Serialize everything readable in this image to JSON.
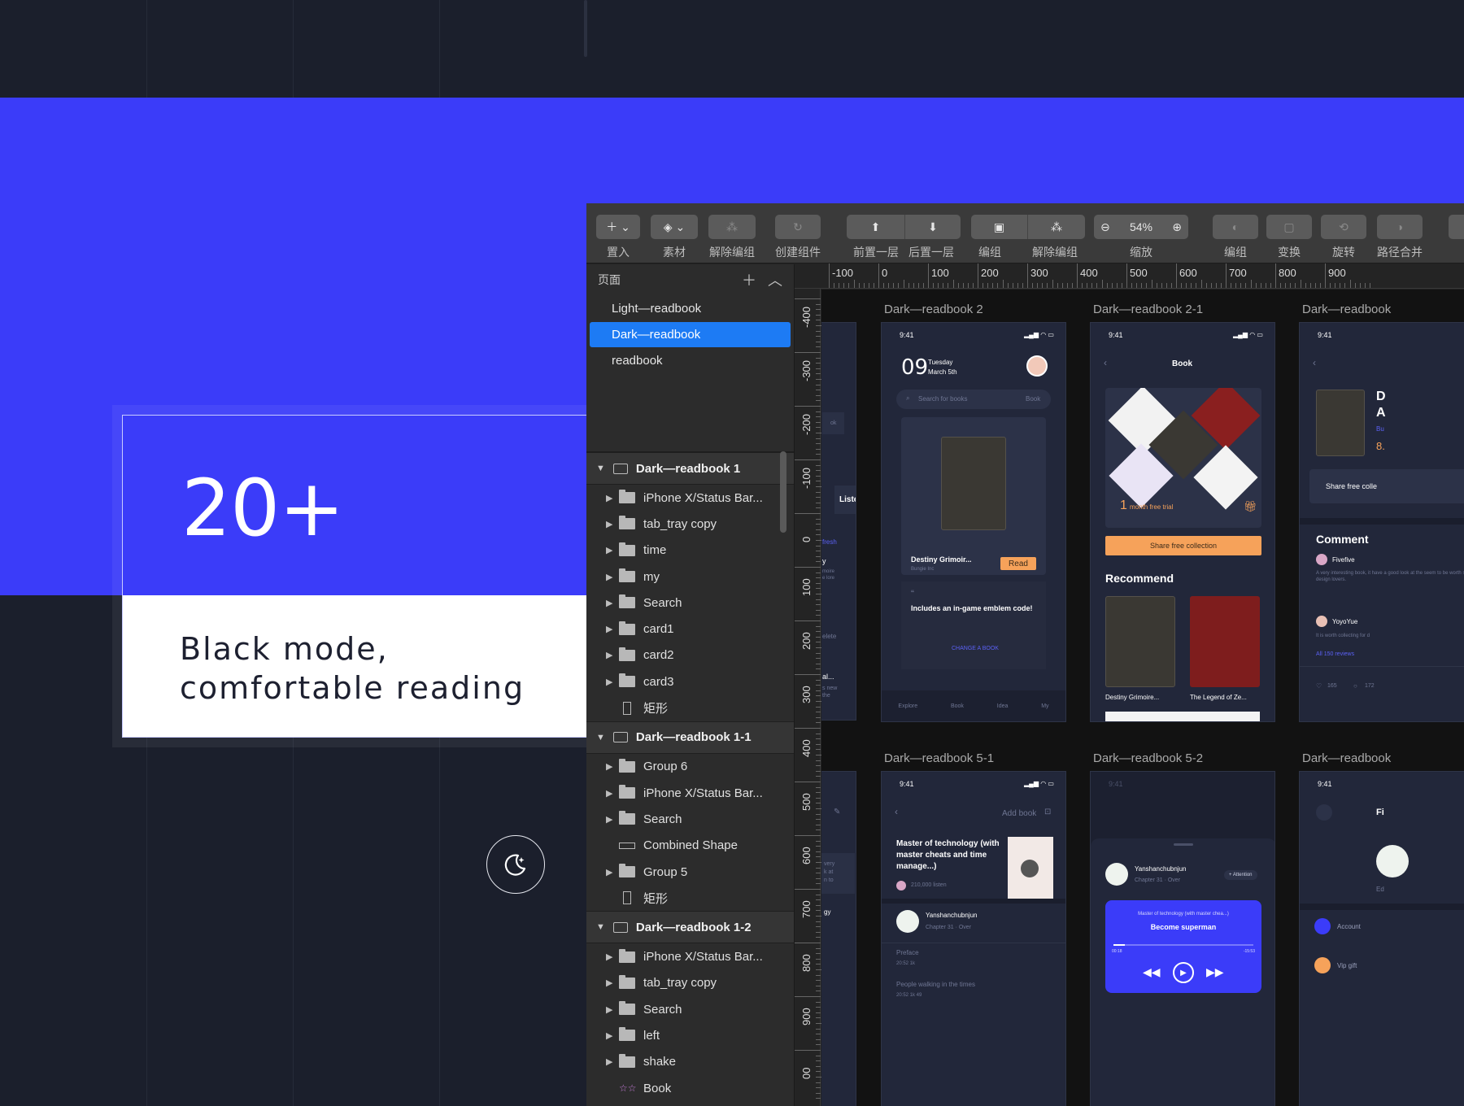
{
  "promo": {
    "number": "20+",
    "caption": "Black mode,\ncomfortable reading"
  },
  "toolbar": {
    "insert": "置入",
    "assets": "素材",
    "ungroup_disabled": "解除编组",
    "create_symbol": "创建组件",
    "bring_forward": "前置一层",
    "send_backward": "后置一层",
    "group": "编组",
    "ungroup": "解除编组",
    "zoom_value": "54%",
    "zoom_label": "缩放",
    "edit": "编组",
    "transform": "变换",
    "rotate": "旋转",
    "combine": "路径合并"
  },
  "sidebar": {
    "pages_title": "页面",
    "pages": [
      "Light—readbook",
      "Dark—readbook",
      "readbook"
    ],
    "artboard1": {
      "name": "Dark—readbook 1",
      "layers": [
        "iPhone X/Status Bar...",
        "tab_tray copy",
        "time",
        "my",
        "Search",
        "card1",
        "card2",
        "card3",
        "矩形"
      ]
    },
    "artboard2": {
      "name": "Dark—readbook 1-1",
      "layers": [
        "Group 6",
        "iPhone X/Status Bar...",
        "Search",
        "Combined Shape",
        "Group 5",
        "矩形"
      ]
    },
    "artboard3": {
      "name": "Dark—readbook 1-2",
      "layers": [
        "iPhone X/Status Bar...",
        "tab_tray copy",
        "Search",
        "left",
        "shake",
        "Book"
      ]
    }
  },
  "ruler_top": [
    "-100",
    "0",
    "100",
    "200",
    "300",
    "400",
    "500",
    "600",
    "700",
    "800",
    "900"
  ],
  "ruler_left": [
    "-400",
    "-300",
    "-200",
    "-100",
    "0",
    "100",
    "200",
    "300",
    "400",
    "500",
    "600",
    "700",
    "800",
    "900",
    "00"
  ],
  "canvas": {
    "titles": [
      "Dark—readbook 2",
      "Dark—readbook 2-1",
      "Dark—readbook",
      "Dark—readbook 5-1",
      "Dark—readbook 5-2",
      "Dark—readbook"
    ],
    "status_time": "9:41",
    "p2": {
      "day": "09",
      "weekday": "Tuesday",
      "date": "March 5th",
      "search_placeholder": "Search for books",
      "search_tag": "Book",
      "book_title": "Destiny Grimoir...",
      "book_author": "Bungie Inc",
      "read": "Read",
      "quote_mark": "“",
      "quote": "Includes an in-game emblem code!",
      "change": "CHANGE A BOOK",
      "tabs": [
        "Explore",
        "Book",
        "Idea",
        "My"
      ]
    },
    "p21": {
      "title": "Book",
      "trial_num": "1",
      "trial": "month free trial",
      "share": "Share free collection",
      "recommend": "Recommend",
      "book1": "Destiny Grimoire...",
      "book2": "The Legend of Ze..."
    },
    "p3": {
      "share": "Share free colle",
      "comment": "Comment",
      "user1": "Fivefive",
      "text1": "A very interesting book, it have a good look at the seem to be worth so mu design lovers.",
      "user2": "YoyoYue",
      "text2": "It is worth collecting for d",
      "reviews": "All 150 reviews",
      "likes": "165",
      "comments": "172",
      "big1": "D",
      "big2": "A",
      "small1": "Bu",
      "small2": "8."
    },
    "p51": {
      "add": "Add book",
      "title": "Master of technology (with master cheats and time manage...)",
      "listen": "210,000 listen",
      "author": "Yanshanchubnjun",
      "chapter": "Chapter 31 · Over",
      "preface": "Preface",
      "preface_meta": "20:52     1k",
      "people": "People walking in the times",
      "people_meta": "20:52     1k     49"
    },
    "p52": {
      "author": "Yanshanchubnjun",
      "chapter": "Chapter 31 · Over",
      "attention": "+ Attention",
      "track": "Master of technology (with master chea...)",
      "song": "Become superman",
      "t_start": "00:18",
      "t_end": "-15:53"
    },
    "p6": {
      "fi": "Fi",
      "ed": "Ed",
      "account": "Account",
      "vip": "Vip gift"
    },
    "left_frag": {
      "listen": "Liste",
      "fresh": "fresh",
      "y": "y",
      "moire": "moire",
      "lore": "e lore",
      "delete": "elete",
      "al": "al...",
      "new": "s new",
      "the": "the",
      "very": "very",
      "kat": "k at",
      "nto": "n to",
      "gy": "gy",
      "ok": "ok"
    }
  },
  "colors": {
    "background": "#1b1f2c",
    "brand_blue": "#3b3cf9",
    "selection_blue": "#1d7bf4",
    "accent_orange": "#f6a25a"
  }
}
